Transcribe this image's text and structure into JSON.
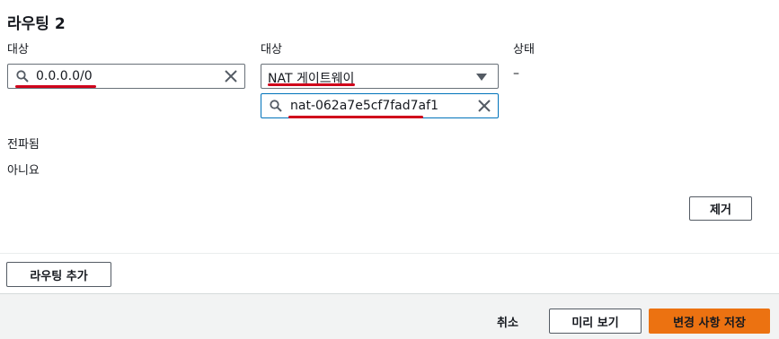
{
  "route": {
    "title": "라우팅 2",
    "destination_label": "대상",
    "destination_value": "0.0.0.0/0",
    "target_label": "대상",
    "target_type": "NAT 게이트웨이",
    "target_value": "nat-062a7e5cf7fad7af1",
    "status_label": "상태",
    "status_value": "–",
    "propagated_label": "전파됨",
    "propagated_value": "아니요",
    "remove_label": "제거"
  },
  "actions": {
    "add_route_label": "라우팅 추가",
    "cancel_label": "취소",
    "preview_label": "미리 보기",
    "save_label": "변경 사항 저장"
  },
  "annotations": {
    "highlight_color": "#d0021b"
  }
}
